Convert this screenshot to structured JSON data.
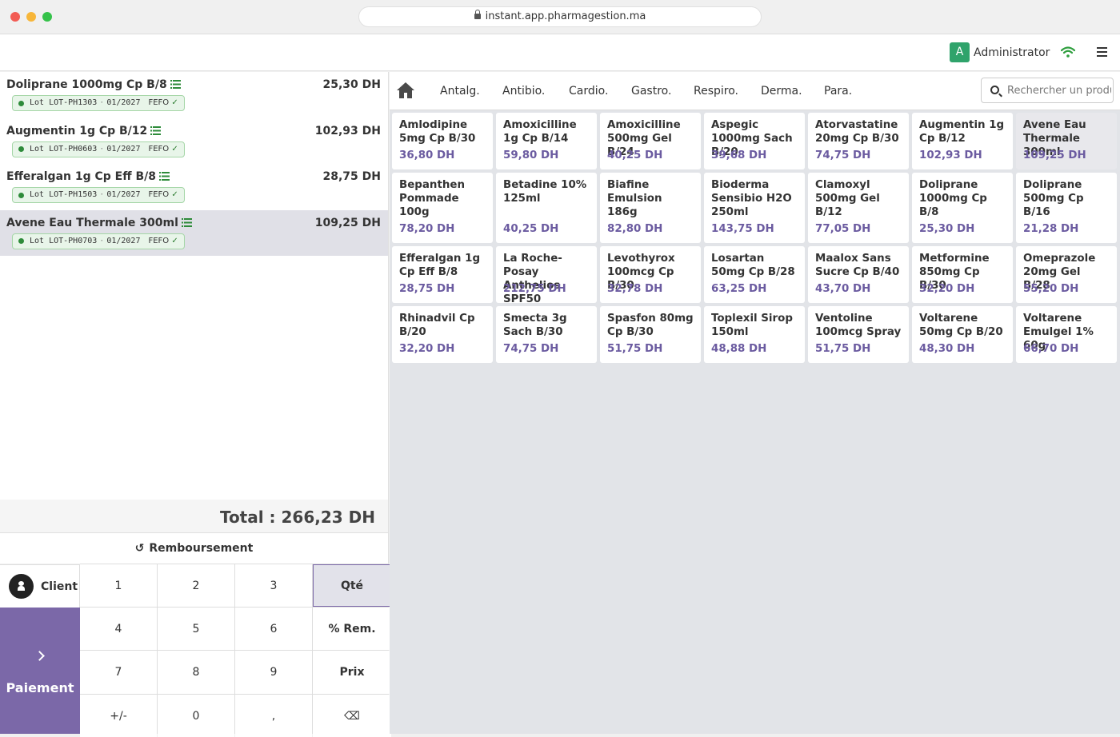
{
  "browser": {
    "url": "instant.app.pharmagestion.ma"
  },
  "header": {
    "avatar_letter": "A",
    "user": "Administrator"
  },
  "order": {
    "lines": [
      {
        "name": "Doliprane 1000mg Cp B/8",
        "price": "25,30 DH",
        "lot": "Lot LOT-PH1303",
        "date": "01/2027",
        "fefo": "FEFO"
      },
      {
        "name": "Augmentin 1g Cp B/12",
        "price": "102,93 DH",
        "lot": "Lot LOT-PH0603",
        "date": "01/2027",
        "fefo": "FEFO"
      },
      {
        "name": "Efferalgan 1g Cp Eff B/8",
        "price": "28,75 DH",
        "lot": "Lot LOT-PH1503",
        "date": "01/2027",
        "fefo": "FEFO"
      },
      {
        "name": "Avene Eau Thermale 300ml",
        "price": "109,25 DH",
        "lot": "Lot LOT-PH0703",
        "date": "01/2027",
        "fefo": "FEFO"
      }
    ],
    "total": "Total : 266,23 DH",
    "refund_label": "Remboursement"
  },
  "keypad": {
    "client_label": "Client",
    "pay_label": "Paiement",
    "keys": [
      "1",
      "2",
      "3",
      "Qté",
      "4",
      "5",
      "6",
      "% Rem.",
      "7",
      "8",
      "9",
      "Prix",
      "+/-",
      "0",
      ",",
      "⌫"
    ]
  },
  "categories": [
    "Antalg.",
    "Antibio.",
    "Cardio.",
    "Gastro.",
    "Respiro.",
    "Derma.",
    "Para."
  ],
  "search": {
    "placeholder": "Rechercher un produit..."
  },
  "products": [
    {
      "name": "Amlodipine 5mg Cp B/30",
      "price": "36,80 DH"
    },
    {
      "name": "Amoxicilline 1g Cp B/14",
      "price": "59,80 DH"
    },
    {
      "name": "Amoxicilline 500mg Gel B/24",
      "price": "40,25 DH"
    },
    {
      "name": "Aspegic 1000mg Sach B/20",
      "price": "39,68 DH"
    },
    {
      "name": "Atorvastatine 20mg Cp B/30",
      "price": "74,75 DH"
    },
    {
      "name": "Augmentin 1g Cp B/12",
      "price": "102,93 DH"
    },
    {
      "name": "Avene Eau Thermale 300ml",
      "price": "109,25 DH"
    },
    {
      "name": "Bepanthen Pommade 100g",
      "price": "78,20 DH"
    },
    {
      "name": "Betadine 10% 125ml",
      "price": "40,25 DH"
    },
    {
      "name": "Biafine Emulsion 186g",
      "price": "82,80 DH"
    },
    {
      "name": "Bioderma Sensibio H2O 250ml",
      "price": "143,75 DH"
    },
    {
      "name": "Clamoxyl 500mg Gel B/12",
      "price": "77,05 DH"
    },
    {
      "name": "Doliprane 1000mg Cp B/8",
      "price": "25,30 DH"
    },
    {
      "name": "Doliprane 500mg Cp B/16",
      "price": "21,28 DH"
    },
    {
      "name": "Efferalgan 1g Cp Eff B/8",
      "price": "28,75 DH"
    },
    {
      "name": "La Roche-Posay Anthelios SPF50",
      "price": "212,75 DH"
    },
    {
      "name": "Levothyrox 100mcg Cp B/30",
      "price": "32,78 DH"
    },
    {
      "name": "Losartan 50mg Cp B/28",
      "price": "63,25 DH"
    },
    {
      "name": "Maalox Sans Sucre Cp B/40",
      "price": "43,70 DH"
    },
    {
      "name": "Metformine 850mg Cp B/30",
      "price": "32,20 DH"
    },
    {
      "name": "Omeprazole 20mg Gel B/28",
      "price": "55,20 DH"
    },
    {
      "name": "Rhinadvil Cp B/20",
      "price": "32,20 DH"
    },
    {
      "name": "Smecta 3g Sach B/30",
      "price": "74,75 DH"
    },
    {
      "name": "Spasfon 80mg Cp B/30",
      "price": "51,75 DH"
    },
    {
      "name": "Toplexil Sirop 150ml",
      "price": "48,88 DH"
    },
    {
      "name": "Ventoline 100mcg Spray",
      "price": "51,75 DH"
    },
    {
      "name": "Voltarene 50mg Cp B/20",
      "price": "48,30 DH"
    },
    {
      "name": "Voltarene Emulgel 1% 60g",
      "price": "66,70 DH"
    }
  ],
  "colors": {
    "accent": "#7b68a8",
    "price": "#6b5ba0",
    "lot_green": "#2e8b3a"
  }
}
